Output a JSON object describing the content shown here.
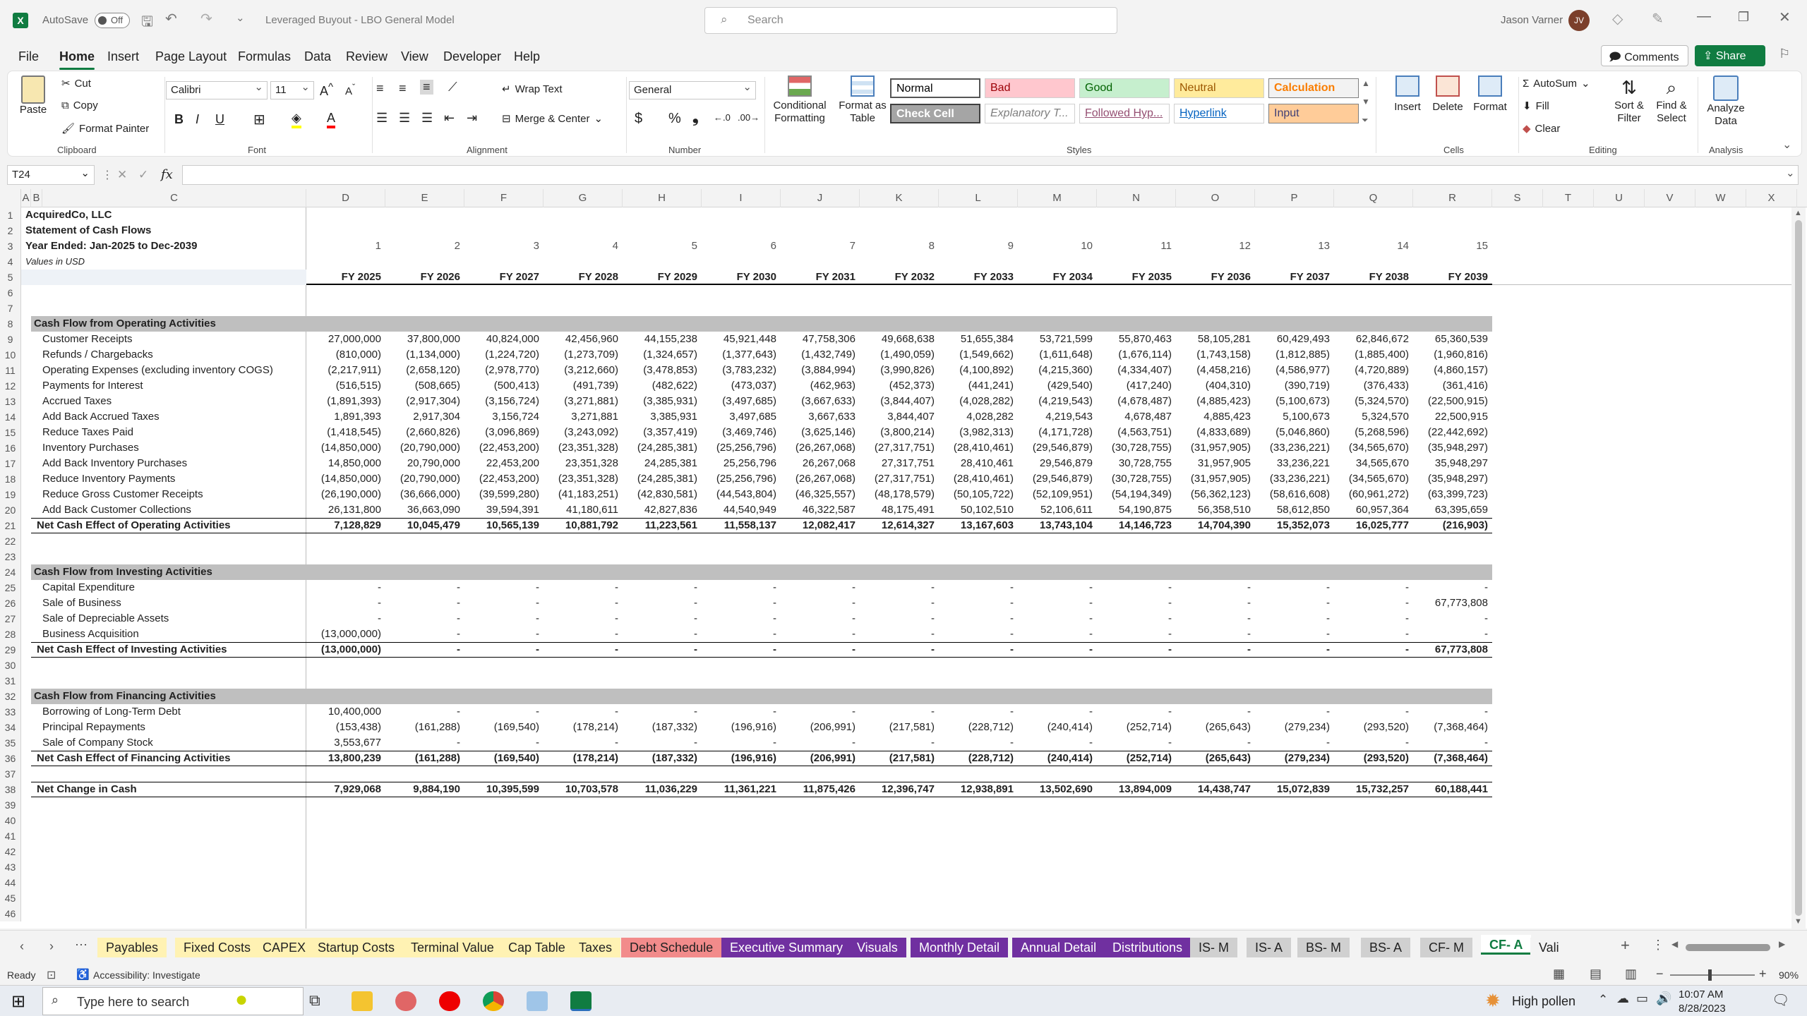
{
  "titlebar": {
    "autosave_label": "AutoSave",
    "autosave_state": "Off",
    "doc_title": "Leveraged Buyout - LBO General Model",
    "search_placeholder": "Search",
    "user_name": "Jason Varner",
    "user_initials": "JV"
  },
  "menu": [
    "File",
    "Home",
    "Insert",
    "Page Layout",
    "Formulas",
    "Data",
    "Review",
    "View",
    "Developer",
    "Help"
  ],
  "menu_active": "Home",
  "comments_label": "Comments",
  "share_label": "Share",
  "ribbon": {
    "clipboard": {
      "paste": "Paste",
      "cut": "Cut",
      "copy": "Copy",
      "format_painter": "Format Painter",
      "label": "Clipboard"
    },
    "font": {
      "name": "Calibri",
      "size": "11",
      "label": "Font"
    },
    "alignment": {
      "wrap": "Wrap Text",
      "merge": "Merge & Center",
      "label": "Alignment"
    },
    "number": {
      "format": "General",
      "label": "Number"
    },
    "styles": {
      "conditional": "Conditional Formatting",
      "format_table": "Format as Table",
      "label": "Styles",
      "cells": [
        {
          "text": "Normal",
          "bg": "#ffffff",
          "fg": "#000000"
        },
        {
          "text": "Bad",
          "bg": "#ffc7ce",
          "fg": "#9c0006"
        },
        {
          "text": "Good",
          "bg": "#c6efce",
          "fg": "#006100"
        },
        {
          "text": "Neutral",
          "bg": "#ffeb9c",
          "fg": "#9c5700"
        },
        {
          "text": "Calculation",
          "bg": "#f2f2f2",
          "fg": "#fa7d00"
        },
        {
          "text": "Check Cell",
          "bg": "#a5a5a5",
          "fg": "#ffffff"
        },
        {
          "text": "Explanatory T...",
          "bg": "#ffffff",
          "fg": "#7f7f7f"
        },
        {
          "text": "Followed Hyp...",
          "bg": "#ffffff",
          "fg": "#954f72"
        },
        {
          "text": "Hyperlink",
          "bg": "#ffffff",
          "fg": "#0563c1"
        },
        {
          "text": "Input",
          "bg": "#ffcc99",
          "fg": "#3f3f76"
        }
      ]
    },
    "cells": {
      "insert": "Insert",
      "delete": "Delete",
      "format": "Format",
      "label": "Cells"
    },
    "editing": {
      "autosum": "AutoSum",
      "fill": "Fill",
      "clear": "Clear",
      "sort": "Sort & Filter",
      "find": "Find & Select",
      "label": "Editing"
    },
    "analysis": {
      "analyze": "Analyze Data",
      "label": "Analysis"
    }
  },
  "namebox": "T24",
  "fx_label": "fx",
  "columns": [
    "A",
    "B",
    "C",
    "D",
    "E",
    "F",
    "G",
    "H",
    "I",
    "J",
    "K",
    "L",
    "M",
    "N",
    "O",
    "P",
    "Q",
    "R",
    "S",
    "T",
    "U",
    "V",
    "W",
    "X"
  ],
  "sheet": {
    "company": "AcquiredCo, LLC",
    "statement": "Statement of Cash Flows",
    "period": "Year Ended: Jan-2025 to Dec-2039",
    "units": "Values in USD",
    "period_numbers": [
      "1",
      "2",
      "3",
      "4",
      "5",
      "6",
      "7",
      "8",
      "9",
      "10",
      "11",
      "12",
      "13",
      "14",
      "15"
    ],
    "years": [
      "FY 2025",
      "FY 2026",
      "FY 2027",
      "FY 2028",
      "FY 2029",
      "FY 2030",
      "FY 2031",
      "FY 2032",
      "FY 2033",
      "FY 2034",
      "FY 2035",
      "FY 2036",
      "FY 2037",
      "FY 2038",
      "FY 2039"
    ],
    "sections": [
      {
        "row": 8,
        "title": "Cash Flow from Operating Activities"
      },
      {
        "row": 24,
        "title": "Cash Flow from Investing Activities"
      },
      {
        "row": 32,
        "title": "Cash Flow from Financing Activities"
      }
    ],
    "rows": [
      {
        "row": 9,
        "label": "Customer Receipts",
        "values": [
          "27,000,000",
          "37,800,000",
          "40,824,000",
          "42,456,960",
          "44,155,238",
          "45,921,448",
          "47,758,306",
          "49,668,638",
          "51,655,384",
          "53,721,599",
          "55,870,463",
          "58,105,281",
          "60,429,493",
          "62,846,672",
          "65,360,539"
        ]
      },
      {
        "row": 10,
        "label": "Refunds / Chargebacks",
        "values": [
          "(810,000)",
          "(1,134,000)",
          "(1,224,720)",
          "(1,273,709)",
          "(1,324,657)",
          "(1,377,643)",
          "(1,432,749)",
          "(1,490,059)",
          "(1,549,662)",
          "(1,611,648)",
          "(1,676,114)",
          "(1,743,158)",
          "(1,812,885)",
          "(1,885,400)",
          "(1,960,816)"
        ]
      },
      {
        "row": 11,
        "label": "Operating Expenses (excluding inventory COGS)",
        "values": [
          "(2,217,911)",
          "(2,658,120)",
          "(2,978,770)",
          "(3,212,660)",
          "(3,478,853)",
          "(3,783,232)",
          "(3,884,994)",
          "(3,990,826)",
          "(4,100,892)",
          "(4,215,360)",
          "(4,334,407)",
          "(4,458,216)",
          "(4,586,977)",
          "(4,720,889)",
          "(4,860,157)"
        ]
      },
      {
        "row": 12,
        "label": "Payments for Interest",
        "values": [
          "(516,515)",
          "(508,665)",
          "(500,413)",
          "(491,739)",
          "(482,622)",
          "(473,037)",
          "(462,963)",
          "(452,373)",
          "(441,241)",
          "(429,540)",
          "(417,240)",
          "(404,310)",
          "(390,719)",
          "(376,433)",
          "(361,416)"
        ]
      },
      {
        "row": 13,
        "label": "Accrued Taxes",
        "values": [
          "(1,891,393)",
          "(2,917,304)",
          "(3,156,724)",
          "(3,271,881)",
          "(3,385,931)",
          "(3,497,685)",
          "(3,667,633)",
          "(3,844,407)",
          "(4,028,282)",
          "(4,219,543)",
          "(4,678,487)",
          "(4,885,423)",
          "(5,100,673)",
          "(5,324,570)",
          "(22,500,915)"
        ]
      },
      {
        "row": 14,
        "label": "Add Back Accrued Taxes",
        "values": [
          "1,891,393",
          "2,917,304",
          "3,156,724",
          "3,271,881",
          "3,385,931",
          "3,497,685",
          "3,667,633",
          "3,844,407",
          "4,028,282",
          "4,219,543",
          "4,678,487",
          "4,885,423",
          "5,100,673",
          "5,324,570",
          "22,500,915"
        ]
      },
      {
        "row": 15,
        "label": "Reduce Taxes Paid",
        "values": [
          "(1,418,545)",
          "(2,660,826)",
          "(3,096,869)",
          "(3,243,092)",
          "(3,357,419)",
          "(3,469,746)",
          "(3,625,146)",
          "(3,800,214)",
          "(3,982,313)",
          "(4,171,728)",
          "(4,563,751)",
          "(4,833,689)",
          "(5,046,860)",
          "(5,268,596)",
          "(22,442,692)"
        ]
      },
      {
        "row": 16,
        "label": "Inventory Purchases",
        "values": [
          "(14,850,000)",
          "(20,790,000)",
          "(22,453,200)",
          "(23,351,328)",
          "(24,285,381)",
          "(25,256,796)",
          "(26,267,068)",
          "(27,317,751)",
          "(28,410,461)",
          "(29,546,879)",
          "(30,728,755)",
          "(31,957,905)",
          "(33,236,221)",
          "(34,565,670)",
          "(35,948,297)"
        ]
      },
      {
        "row": 17,
        "label": "Add Back Inventory Purchases",
        "values": [
          "14,850,000",
          "20,790,000",
          "22,453,200",
          "23,351,328",
          "24,285,381",
          "25,256,796",
          "26,267,068",
          "27,317,751",
          "28,410,461",
          "29,546,879",
          "30,728,755",
          "31,957,905",
          "33,236,221",
          "34,565,670",
          "35,948,297"
        ]
      },
      {
        "row": 18,
        "label": "Reduce Inventory Payments",
        "values": [
          "(14,850,000)",
          "(20,790,000)",
          "(22,453,200)",
          "(23,351,328)",
          "(24,285,381)",
          "(25,256,796)",
          "(26,267,068)",
          "(27,317,751)",
          "(28,410,461)",
          "(29,546,879)",
          "(30,728,755)",
          "(31,957,905)",
          "(33,236,221)",
          "(34,565,670)",
          "(35,948,297)"
        ]
      },
      {
        "row": 19,
        "label": "Reduce Gross Customer Receipts",
        "values": [
          "(26,190,000)",
          "(36,666,000)",
          "(39,599,280)",
          "(41,183,251)",
          "(42,830,581)",
          "(44,543,804)",
          "(46,325,557)",
          "(48,178,579)",
          "(50,105,722)",
          "(52,109,951)",
          "(54,194,349)",
          "(56,362,123)",
          "(58,616,608)",
          "(60,961,272)",
          "(63,399,723)"
        ]
      },
      {
        "row": 20,
        "label": "Add Back Customer Collections",
        "values": [
          "26,131,800",
          "36,663,090",
          "39,594,391",
          "41,180,611",
          "42,827,836",
          "44,540,949",
          "46,322,587",
          "48,175,491",
          "50,102,510",
          "52,106,611",
          "54,190,875",
          "56,358,510",
          "58,612,850",
          "60,957,364",
          "63,395,659"
        ]
      },
      {
        "row": 21,
        "label": "Net Cash Effect of Operating Activities",
        "total": true,
        "values": [
          "7,128,829",
          "10,045,479",
          "10,565,139",
          "10,881,792",
          "11,223,561",
          "11,558,137",
          "12,082,417",
          "12,614,327",
          "13,167,603",
          "13,743,104",
          "14,146,723",
          "14,704,390",
          "15,352,073",
          "16,025,777",
          "(216,903)"
        ]
      },
      {
        "row": 25,
        "label": "Capital Expenditure",
        "values": [
          "-",
          "-",
          "-",
          "-",
          "-",
          "-",
          "-",
          "-",
          "-",
          "-",
          "-",
          "-",
          "-",
          "-",
          "-"
        ]
      },
      {
        "row": 26,
        "label": "Sale of Business",
        "values": [
          "-",
          "-",
          "-",
          "-",
          "-",
          "-",
          "-",
          "-",
          "-",
          "-",
          "-",
          "-",
          "-",
          "-",
          "67,773,808"
        ]
      },
      {
        "row": 27,
        "label": "Sale of Depreciable Assets",
        "values": [
          "-",
          "-",
          "-",
          "-",
          "-",
          "-",
          "-",
          "-",
          "-",
          "-",
          "-",
          "-",
          "-",
          "-",
          "-"
        ]
      },
      {
        "row": 28,
        "label": "Business Acquisition",
        "values": [
          "(13,000,000)",
          "-",
          "-",
          "-",
          "-",
          "-",
          "-",
          "-",
          "-",
          "-",
          "-",
          "-",
          "-",
          "-",
          "-"
        ]
      },
      {
        "row": 29,
        "label": "Net Cash Effect of Investing Activities",
        "total": true,
        "values": [
          "(13,000,000)",
          "-",
          "-",
          "-",
          "-",
          "-",
          "-",
          "-",
          "-",
          "-",
          "-",
          "-",
          "-",
          "-",
          "67,773,808"
        ]
      },
      {
        "row": 33,
        "label": "Borrowing of Long-Term Debt",
        "values": [
          "10,400,000",
          "-",
          "-",
          "-",
          "-",
          "-",
          "-",
          "-",
          "-",
          "-",
          "-",
          "-",
          "-",
          "-",
          "-"
        ]
      },
      {
        "row": 34,
        "label": "Principal Repayments",
        "values": [
          "(153,438)",
          "(161,288)",
          "(169,540)",
          "(178,214)",
          "(187,332)",
          "(196,916)",
          "(206,991)",
          "(217,581)",
          "(228,712)",
          "(240,414)",
          "(252,714)",
          "(265,643)",
          "(279,234)",
          "(293,520)",
          "(7,368,464)"
        ]
      },
      {
        "row": 35,
        "label": "Sale of Company Stock",
        "values": [
          "3,553,677",
          "-",
          "-",
          "-",
          "-",
          "-",
          "-",
          "-",
          "-",
          "-",
          "-",
          "-",
          "-",
          "-",
          "-"
        ]
      },
      {
        "row": 36,
        "label": "Net Cash Effect of Financing Activities",
        "total": true,
        "values": [
          "13,800,239",
          "(161,288)",
          "(169,540)",
          "(178,214)",
          "(187,332)",
          "(196,916)",
          "(206,991)",
          "(217,581)",
          "(228,712)",
          "(240,414)",
          "(252,714)",
          "(265,643)",
          "(279,234)",
          "(293,520)",
          "(7,368,464)"
        ]
      },
      {
        "row": 38,
        "label": "Net Change in Cash",
        "total": true,
        "values": [
          "7,929,068",
          "9,884,190",
          "10,395,599",
          "10,703,578",
          "11,036,229",
          "11,361,221",
          "11,875,426",
          "12,396,747",
          "12,938,891",
          "13,502,690",
          "13,894,009",
          "14,438,747",
          "15,072,839",
          "15,732,257",
          "60,188,441"
        ]
      }
    ]
  },
  "sheet_tabs": [
    {
      "name": "Payables",
      "bg": "#fff2b3",
      "fg": "#222"
    },
    {
      "name": "Fixed Costs",
      "bg": "#fff2b3",
      "fg": "#222"
    },
    {
      "name": "CAPEX",
      "bg": "#fff2b3",
      "fg": "#222"
    },
    {
      "name": "Startup Costs",
      "bg": "#fff2b3",
      "fg": "#222"
    },
    {
      "name": "Terminal Value",
      "bg": "#fff2b3",
      "fg": "#222"
    },
    {
      "name": "Cap Table",
      "bg": "#fff2b3",
      "fg": "#222"
    },
    {
      "name": "Taxes",
      "bg": "#fff2b3",
      "fg": "#222"
    },
    {
      "name": "Debt Schedule",
      "bg": "#f28b8b",
      "fg": "#222"
    },
    {
      "name": "Executive Summary",
      "bg": "#7030a0",
      "fg": "#ffffff"
    },
    {
      "name": "Visuals",
      "bg": "#7030a0",
      "fg": "#ffffff"
    },
    {
      "name": "Monthly Detail",
      "bg": "#7030a0",
      "fg": "#ffffff"
    },
    {
      "name": "Annual Detail",
      "bg": "#7030a0",
      "fg": "#ffffff"
    },
    {
      "name": "Distributions",
      "bg": "#7030a0",
      "fg": "#ffffff"
    },
    {
      "name": "IS- M",
      "bg": "#d0d0d0",
      "fg": "#222"
    },
    {
      "name": "IS- A",
      "bg": "#d0d0d0",
      "fg": "#222"
    },
    {
      "name": "BS- M",
      "bg": "#d0d0d0",
      "fg": "#222"
    },
    {
      "name": "BS- A",
      "bg": "#d0d0d0",
      "fg": "#222"
    },
    {
      "name": "CF- M",
      "bg": "#d0d0d0",
      "fg": "#222"
    },
    {
      "name": "CF- A",
      "bg": "#ffffff",
      "fg": "#107c41",
      "active": true
    },
    {
      "name": "Vali",
      "bg": "#f3f3f3",
      "fg": "#222"
    }
  ],
  "status": {
    "ready": "Ready",
    "accessibility": "Accessibility: Investigate",
    "zoom": "90%"
  },
  "taskbar": {
    "search_placeholder": "Type here to search",
    "weather": "High pollen",
    "time": "10:07 AM",
    "date": "8/28/2023"
  },
  "colors": {
    "excel_green": "#107c41",
    "section_fill": "#bfbfbf",
    "share_bg": "#107c41"
  }
}
